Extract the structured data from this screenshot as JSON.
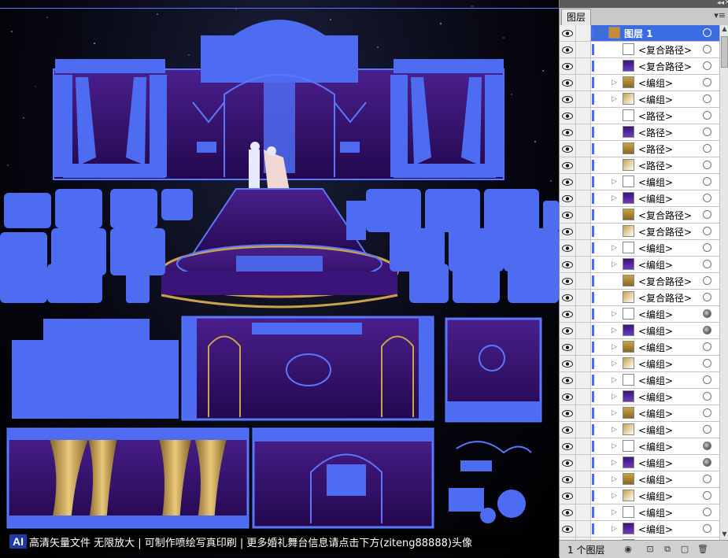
{
  "banner": {
    "ai_badge": "AI",
    "text": "高清矢量文件 无限放大 | 可制作喷绘写真印刷 | 更多婚礼舞台信息请点击下方(ziteng88888)头像"
  },
  "panel": {
    "tab_label": "图层",
    "footer_count": "1 个图层",
    "layers": [
      {
        "label": "图层 1",
        "selected": true,
        "expand": true,
        "target_filled": false
      },
      {
        "label": "<复合路径>",
        "expand": false,
        "target_filled": false
      },
      {
        "label": "<复合路径>",
        "expand": false,
        "target_filled": false
      },
      {
        "label": "<编组>",
        "expand": true,
        "target_filled": false
      },
      {
        "label": "<编组>",
        "expand": true,
        "target_filled": false
      },
      {
        "label": "<路径>",
        "expand": false,
        "target_filled": false
      },
      {
        "label": "<路径>",
        "expand": false,
        "target_filled": false
      },
      {
        "label": "<路径>",
        "expand": false,
        "target_filled": false
      },
      {
        "label": "<路径>",
        "expand": false,
        "target_filled": false
      },
      {
        "label": "<编组>",
        "expand": true,
        "target_filled": false
      },
      {
        "label": "<编组>",
        "expand": true,
        "target_filled": false
      },
      {
        "label": "<复合路径>",
        "expand": false,
        "target_filled": false
      },
      {
        "label": "<复合路径>",
        "expand": false,
        "target_filled": false
      },
      {
        "label": "<编组>",
        "expand": true,
        "target_filled": false
      },
      {
        "label": "<编组>",
        "expand": true,
        "target_filled": false
      },
      {
        "label": "<复合路径>",
        "expand": false,
        "target_filled": false
      },
      {
        "label": "<复合路径>",
        "expand": false,
        "target_filled": false
      },
      {
        "label": "<编组>",
        "expand": true,
        "target_filled": true
      },
      {
        "label": "<编组>",
        "expand": true,
        "target_filled": true
      },
      {
        "label": "<编组>",
        "expand": true,
        "target_filled": false
      },
      {
        "label": "<编组>",
        "expand": true,
        "target_filled": false
      },
      {
        "label": "<编组>",
        "expand": true,
        "target_filled": false
      },
      {
        "label": "<编组>",
        "expand": true,
        "target_filled": false
      },
      {
        "label": "<编组>",
        "expand": true,
        "target_filled": false
      },
      {
        "label": "<编组>",
        "expand": true,
        "target_filled": false
      },
      {
        "label": "<编组>",
        "expand": true,
        "target_filled": true
      },
      {
        "label": "<编组>",
        "expand": true,
        "target_filled": true
      },
      {
        "label": "<编组>",
        "expand": true,
        "target_filled": false
      },
      {
        "label": "<编组>",
        "expand": true,
        "target_filled": false
      },
      {
        "label": "<编组>",
        "expand": true,
        "target_filled": false
      },
      {
        "label": "<编组>",
        "expand": true,
        "target_filled": false
      },
      {
        "label": "<编组>",
        "expand": true,
        "target_filled": false
      },
      {
        "label": "<复合路径>",
        "expand": false,
        "target_filled": false
      }
    ]
  },
  "colors": {
    "wireframe_blue": "#4d6cf2",
    "purple": "#3a1478",
    "gold": "#c9a24a",
    "selection_blue": "#3b6be0"
  }
}
